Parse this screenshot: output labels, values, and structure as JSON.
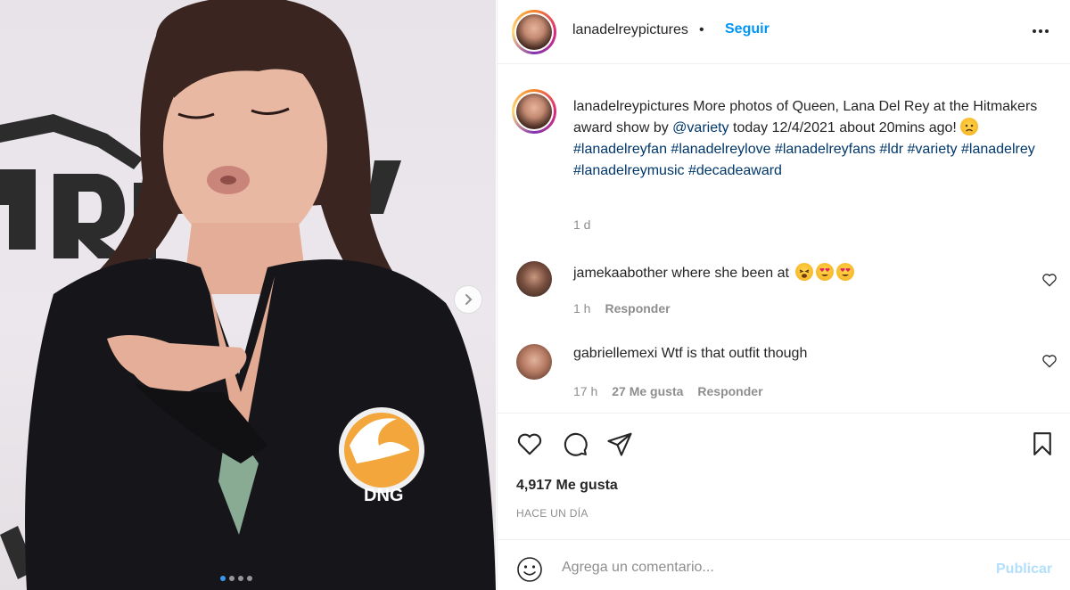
{
  "post": {
    "username": "lanadelreypictures",
    "separator": "•",
    "follow_label": "Seguir",
    "more_icon": "more-horizontal-icon"
  },
  "caption": {
    "username": "lanadelreypictures",
    "text_1": " More photos of Queen, Lana Del Rey at the Hitmakers award show by ",
    "mention": "@variety",
    "text_2": " today 12/4/2021 about 20mins ago! ",
    "hashtags": [
      "#lanadelreyfan",
      "#lanadelreylove",
      "#lanadelreyfans",
      "#ldr",
      "#variety",
      "#lanadelrey",
      "#lanadelreymusic",
      "#decadeaward"
    ],
    "time": "1 d"
  },
  "comments": [
    {
      "username": "jamekaabother",
      "text": " where she been at ",
      "time": "1 h",
      "likes": "",
      "reply_label": "Responder"
    },
    {
      "username": "gabriellemexi",
      "text": " Wtf is that outfit though",
      "time": "17 h",
      "likes": "27 Me gusta",
      "reply_label": "Responder"
    }
  ],
  "actions": {
    "like_icon": "heart-icon",
    "comment_icon": "comment-icon",
    "share_icon": "paper-plane-icon",
    "save_icon": "bookmark-icon"
  },
  "likes_label": "4,917 Me gusta",
  "time_ago": "HACE UN DÍA",
  "add_comment": {
    "placeholder": "Agrega un comentario...",
    "publish_label": "Publicar"
  },
  "carousel": {
    "slide_count": 4,
    "active_index": 0
  },
  "colors": {
    "link": "#00376b",
    "follow": "#0095f6",
    "publish_disabled": "#b2dffc",
    "muted": "#8e8e8e"
  }
}
